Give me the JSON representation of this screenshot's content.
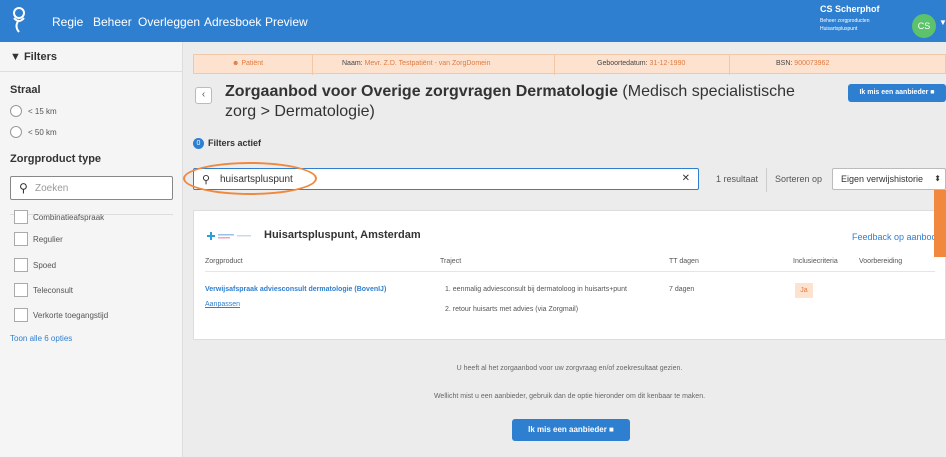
{
  "nav": {
    "items": [
      "Regie",
      "Beheer",
      "Overleggen",
      "Adresboek",
      "Preview"
    ],
    "user_name": "CS Scherphof",
    "user_role": "Beheer zorgproducten",
    "user_org": "Huisartspluspunt",
    "avatar_initials": "CS"
  },
  "sidebar": {
    "filters_label": "Filters",
    "straal_label": "Straal",
    "straal_options": [
      "< 15 km",
      "< 50 km"
    ],
    "product_type_label": "Zorgproduct type",
    "search_placeholder": "Zoeken",
    "product_options": [
      "Combinatieafspraak",
      "Regulier",
      "Spoed",
      "Teleconsult",
      "Verkorte toegangstijd"
    ],
    "show_all": "Toon alle 6 opties"
  },
  "patient": {
    "patient_label": "Patiënt",
    "name_key": "Naam:",
    "name_val": "Mevr. Z.D. Testpatiënt - van ZorgDomein",
    "dob_key": "Geboortedatum:",
    "dob_val": "31-12-1990",
    "bsn_key": "BSN:",
    "bsn_val": "900073962"
  },
  "header": {
    "title_bold": "Zorgaanbod voor Overige zorgvragen Dermatologie",
    "title_rest": " (Medisch specialistische zorg > Dermatologie)",
    "miss_button": "Ik mis een aanbieder"
  },
  "filters_active": {
    "count": "0",
    "label": "Filters actief"
  },
  "search": {
    "value": "huisartspluspunt",
    "results": "1 resultaat",
    "sort_label": "Sorteren op",
    "sort_value": "Eigen verwijshistorie"
  },
  "provider": {
    "name": "Huisartspluspunt, Amsterdam",
    "feedback": "Feedback op aanbod",
    "columns": [
      "Zorgproduct",
      "Traject",
      "TT dagen",
      "Inclusiecriteria",
      "Voorbereiding"
    ],
    "product_name": "Verwijsafspraak adviesconsult dermatologie (BovenIJ)",
    "adjust_link": "Aanpassen",
    "traject_1": "1. eenmalig adviesconsult bij dermatoloog in huisarts+punt",
    "traject_2": "2. retour huisarts met advies (via Zorgmail)",
    "tt_days": "7 dagen",
    "inclusion": "Ja"
  },
  "footer": {
    "info_1": "U heeft al het zorgaanbod voor uw zorgvraag en/of zoekresultaat gezien.",
    "info_2": "Wellicht mist u een aanbieder, gebruik dan de optie hieronder om dit kenbaar te maken.",
    "miss_button": "Ik mis een aanbieder"
  },
  "colors": {
    "primary": "#2f7fd1",
    "accent": "#f0883e",
    "patient_bar": "#fde3cf",
    "avatar": "#5cc26b"
  }
}
